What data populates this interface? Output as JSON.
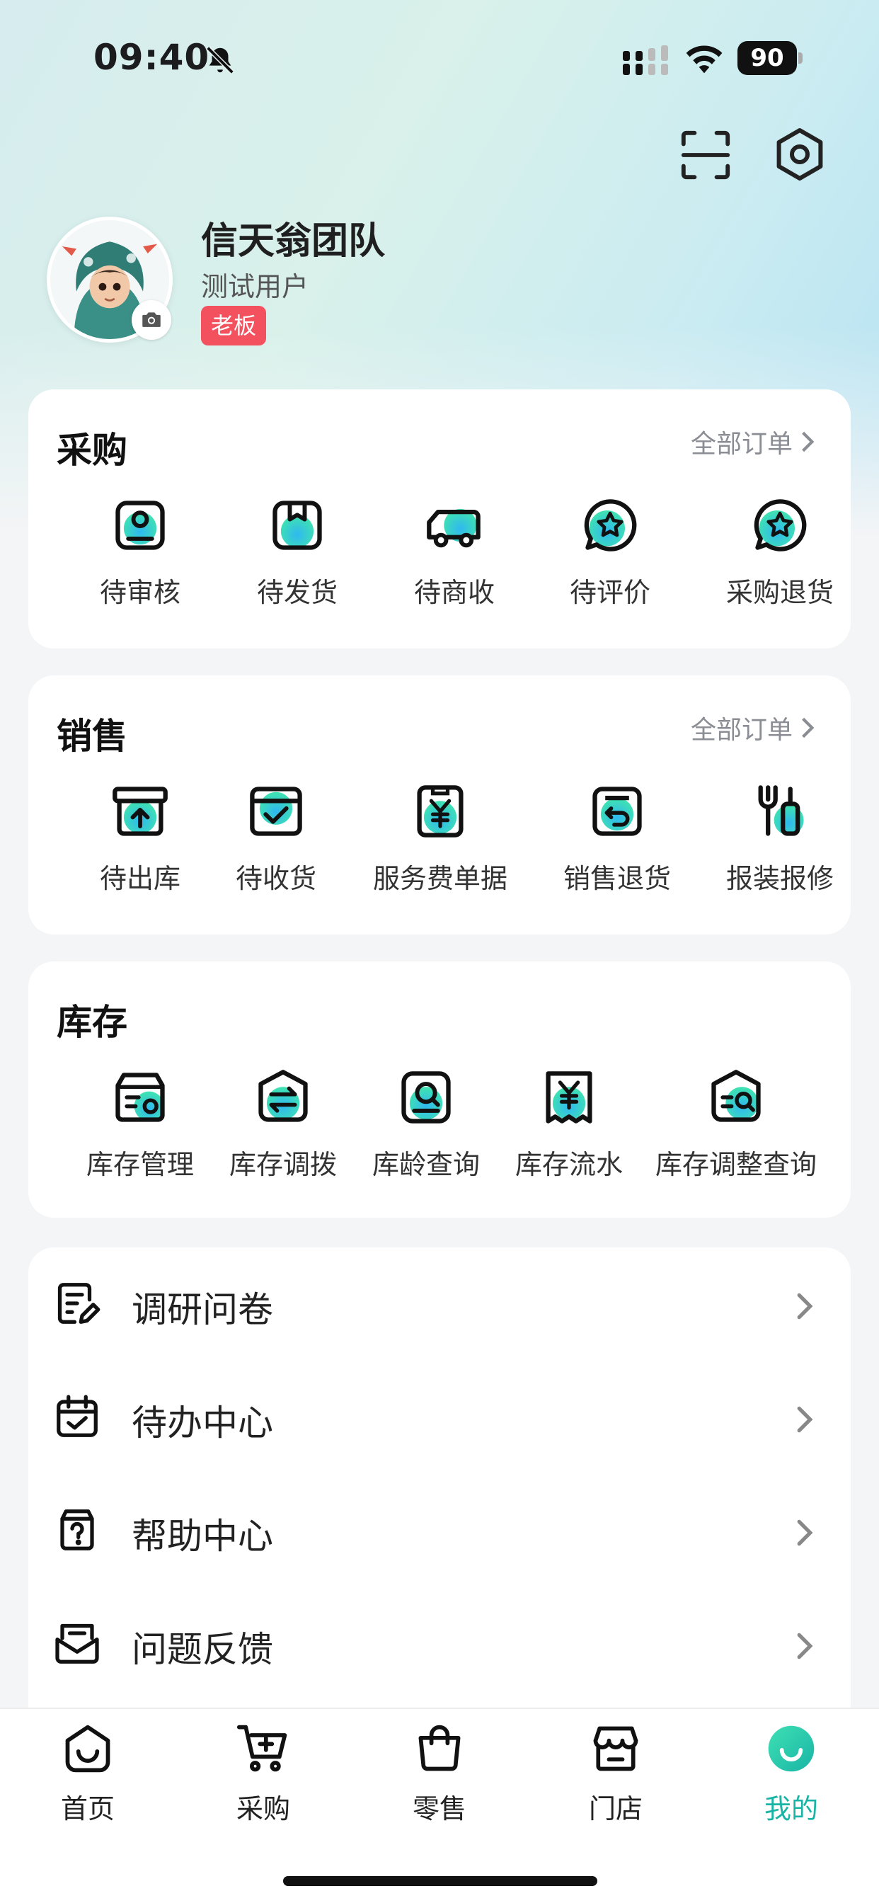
{
  "status_bar": {
    "time": "09:40",
    "battery": "90",
    "bell_icon": "bell-slash-icon"
  },
  "header_actions": {
    "scan_icon": "scan-icon",
    "settings_icon": "settings-icon"
  },
  "profile": {
    "team_name": "信天翁团队",
    "user_name": "测试用户",
    "role_badge": "老板"
  },
  "purchase": {
    "title": "采购",
    "all_orders": "全部订单",
    "items": [
      {
        "label": "待审核",
        "icon": "review-icon"
      },
      {
        "label": "待发货",
        "icon": "package-icon"
      },
      {
        "label": "待商收",
        "icon": "truck-icon"
      },
      {
        "label": "待评价",
        "icon": "star-chat-icon"
      },
      {
        "label": "采购退货",
        "icon": "star-chat-icon"
      }
    ]
  },
  "sales": {
    "title": "销售",
    "all_orders": "全部订单",
    "items": [
      {
        "label": "待出库",
        "icon": "outbound-box-icon"
      },
      {
        "label": "待收货",
        "icon": "receive-box-icon"
      },
      {
        "label": "服务费单据",
        "icon": "yuan-document-icon"
      },
      {
        "label": "销售退货",
        "icon": "return-icon"
      },
      {
        "label": "报装报修",
        "icon": "tools-icon"
      }
    ]
  },
  "inventory": {
    "title": "库存",
    "items": [
      {
        "label": "库存管理",
        "icon": "inventory-settings-icon"
      },
      {
        "label": "库存调拨",
        "icon": "transfer-icon"
      },
      {
        "label": "库龄查询",
        "icon": "age-search-icon"
      },
      {
        "label": "库存流水",
        "icon": "yuan-receipt-icon"
      },
      {
        "label": "库存调整查询",
        "icon": "adjust-search-icon"
      }
    ]
  },
  "menu": [
    {
      "label": "调研问卷",
      "icon": "survey-icon"
    },
    {
      "label": "待办中心",
      "icon": "calendar-check-icon"
    },
    {
      "label": "帮助中心",
      "icon": "help-icon"
    },
    {
      "label": "问题反馈",
      "icon": "feedback-icon"
    }
  ],
  "tabbar": {
    "items": [
      {
        "label": "首页",
        "icon": "home-icon"
      },
      {
        "label": "采购",
        "icon": "cart-icon"
      },
      {
        "label": "零售",
        "icon": "bag-icon"
      },
      {
        "label": "门店",
        "icon": "store-icon"
      },
      {
        "label": "我的",
        "icon": "profile-smile-icon"
      }
    ],
    "active_index": 4
  },
  "colors": {
    "accent": "#19b4a5",
    "badge": "#f4515f",
    "icon_gradient_start": "#3ee0b4",
    "icon_gradient_end": "#2fb8f0"
  }
}
